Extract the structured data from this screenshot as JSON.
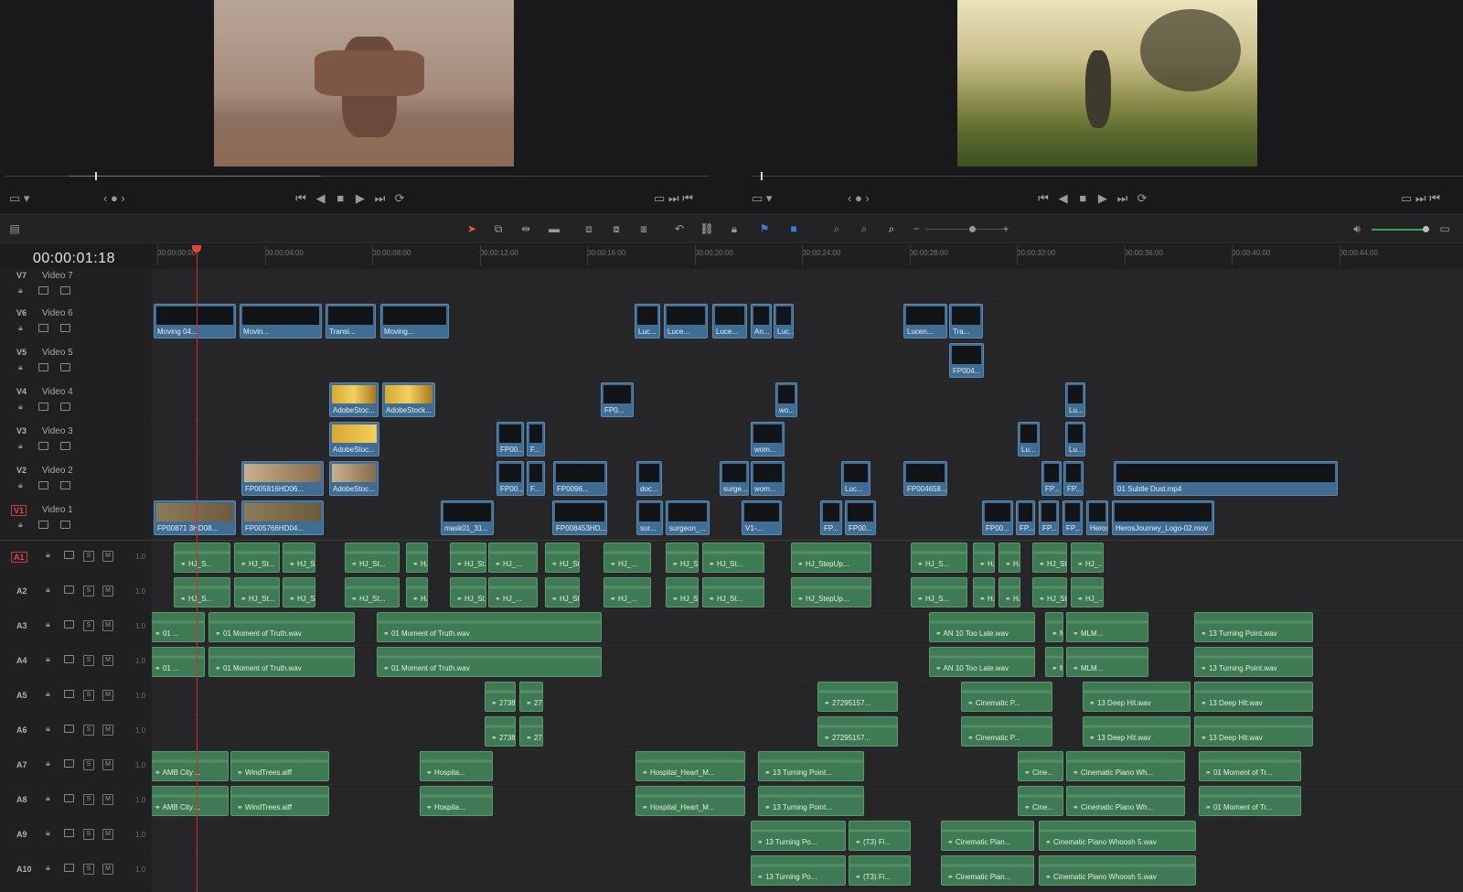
{
  "timeline": {
    "timecode": "00:00:01:18",
    "ruler_ticks": [
      "00:00:00:00",
      "00:00:04:00",
      "00:00:08:00",
      "00:00:12:00",
      "00:00:16:00",
      "00:00:20:00",
      "00:00:24:00",
      "00:00:28:00",
      "00:00:32:00",
      "00:00:36:00",
      "00:00:40:00",
      "00:00:44:00"
    ]
  },
  "video_tracks": [
    {
      "id": "V7",
      "name": "Video 7"
    },
    {
      "id": "V6",
      "name": "Video 6"
    },
    {
      "id": "V5",
      "name": "Video 5"
    },
    {
      "id": "V4",
      "name": "Video 4"
    },
    {
      "id": "V3",
      "name": "Video 3"
    },
    {
      "id": "V2",
      "name": "Video 2"
    },
    {
      "id": "V1",
      "name": "Video 1"
    }
  ],
  "audio_tracks": [
    {
      "id": "A1",
      "level": "1.0"
    },
    {
      "id": "A2",
      "level": "1.0"
    },
    {
      "id": "A3",
      "level": "1.0"
    },
    {
      "id": "A4",
      "level": "1.0"
    },
    {
      "id": "A5",
      "level": "1.0"
    },
    {
      "id": "A6",
      "level": "1.0"
    },
    {
      "id": "A7",
      "level": "1.0"
    },
    {
      "id": "A8",
      "level": "1.0"
    },
    {
      "id": "A9",
      "level": "1.0"
    },
    {
      "id": "A10",
      "level": "1.0"
    }
  ],
  "video_clips": {
    "v6": [
      "Moving 04...",
      "Movin...",
      "Transi...",
      "Moving...",
      "Luc...",
      "Luce...",
      "Luce...",
      "An...",
      "Luc...",
      "Lucen...",
      "Tra..."
    ],
    "v5": [
      "FP004..."
    ],
    "v4": [
      "AdobeStoc...",
      "AdobeStock...",
      "FP0...",
      "wo...",
      "Lu..."
    ],
    "v3": [
      "AdobeStoc...",
      "FP00...",
      "F...",
      "wom...",
      "Lu...",
      "Lu..."
    ],
    "v2": [
      "FP005816HD06...",
      "AdobeStoc...",
      "FP00...",
      "F...",
      "FP0096...",
      "doc...",
      "surge...",
      "wom...",
      "Luc...",
      "FP004658...",
      "FP...",
      "FP...",
      "01 Subtle Dust.mp4"
    ],
    "v1": [
      "FP00871 3HD08...",
      "FP005766HD04...",
      "mask01_31...",
      "FP008453HD...",
      "sur...",
      "surgeon_...",
      "V1-...",
      "FP...",
      "FP00...",
      "FP00...",
      "FP...",
      "FP...",
      "FP...",
      "HerosJourney_Logo-01.mov",
      "HerosJourney_Logo-02.mov"
    ]
  },
  "audio_clips": {
    "a1": [
      "HJ_S...",
      "HJ_St...",
      "HJ_Ste...",
      "HJ_St...",
      "HJ...",
      "HJ_St...",
      "HJ_...",
      "HJ_Ste...",
      "HJ_...",
      "HJ_Ste...",
      "HJ_St...",
      "HJ_StepUp...",
      "HJ_S...",
      "HJ...",
      "HJ...",
      "HJ_St...",
      "HJ_..."
    ],
    "a2": [
      "HJ_S...",
      "HJ_St...",
      "HJ_Ste...",
      "HJ_St...",
      "HJ...",
      "HJ_St...",
      "HJ_...",
      "HJ_Ste...",
      "HJ_...",
      "HJ_Ste...",
      "HJ_St...",
      "HJ_StepUp...",
      "HJ_S...",
      "HJ...",
      "HJ...",
      "HJ_St...",
      "HJ_..."
    ],
    "a3": [
      "01 ...",
      "01 Moment of Truth.wav",
      "01 Moment of Truth.wav",
      "AN 10 Too Late.wav",
      "M...",
      "MLM...",
      "13 Turning Point.wav"
    ],
    "a4": [
      "01 ...",
      "01 Moment of Truth.wav",
      "01 Moment of Truth.wav",
      "AN 10 Too Late.wav",
      "M...",
      "MLM...",
      "13 Turning Point.wav"
    ],
    "a5": [
      "27380...",
      "273...",
      "27295157...",
      "Cinematic P...",
      "13 Deep Hit.wav",
      "13 Deep Hit.wav"
    ],
    "a6": [
      "27380...",
      "273...",
      "27295157...",
      "Cinematic P...",
      "13 Deep Hit.wav",
      "13 Deep Hit.wav"
    ],
    "a7": [
      "AMB City ...",
      "WindTrees.aiff",
      "Hospita...",
      "Hospital_Heart_M...",
      "13 Turning Point...",
      "Cine...",
      "Cinematic Piano Wh...",
      "01 Moment of Tr..."
    ],
    "a8": [
      "AMB City ...",
      "WindTrees.aiff",
      "Hospita...",
      "Hospital_Heart_M...",
      "13 Turning Point...",
      "Cine...",
      "Cinematic Piano Wh...",
      "01 Moment of Tr..."
    ],
    "a9": [
      "13 Turning Po...",
      "(T3) Fi...",
      "Cinematic Pian...",
      "Cinematic Piano Whoosh 5.wav"
    ],
    "a10": [
      "13 Turning Po...",
      "(T3) Fi...",
      "Cinematic Pian...",
      "Cinematic Piano Whoosh 5.wav"
    ]
  },
  "colors": {
    "video_clip": "#3f6d94",
    "audio_clip": "#3e7a53",
    "playhead": "#d0302a",
    "background": "#1c1c1e"
  },
  "icons": [
    "layout-icon",
    "prev-icon",
    "stop-icon",
    "play-icon",
    "next-icon",
    "loop-icon",
    "pointer-icon",
    "blade-icon",
    "link-icon",
    "lock-icon",
    "flag-icon",
    "zoom-icon",
    "volume-icon"
  ]
}
